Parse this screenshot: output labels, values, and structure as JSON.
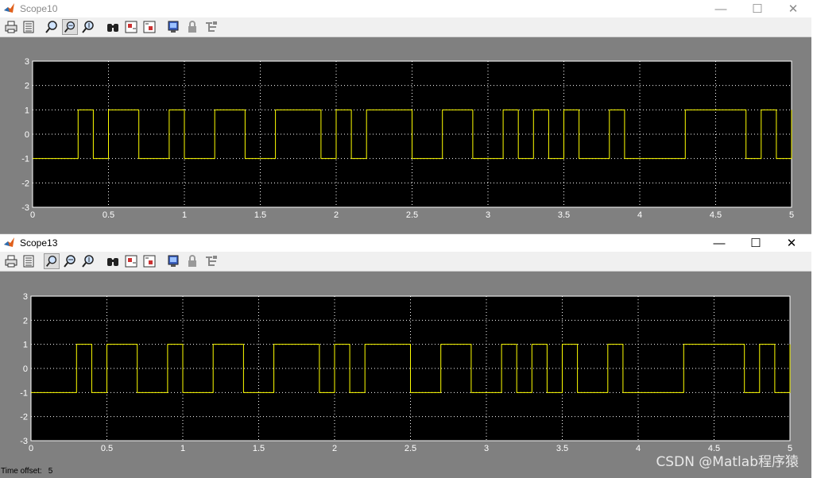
{
  "windows": [
    {
      "title": "Scope10",
      "toolbar_icons": [
        "print-icon",
        "parameters-icon",
        "zoom-icon",
        "zoom-x-icon",
        "zoom-y-icon",
        "autoscale-icon",
        "save-axes-icon",
        "restore-axes-icon",
        "floating-scope-icon",
        "lock-icon",
        "signal-selector-icon"
      ],
      "pressed_tool": "zoom-x-icon"
    },
    {
      "title": "Scope13",
      "toolbar_icons": [
        "print-icon",
        "parameters-icon",
        "zoom-icon",
        "zoom-x-icon",
        "zoom-y-icon",
        "autoscale-icon",
        "save-axes-icon",
        "restore-axes-icon",
        "floating-scope-icon",
        "lock-icon",
        "signal-selector-icon"
      ],
      "pressed_tool": "zoom-icon"
    }
  ],
  "window_controls": {
    "minimize": "—",
    "maximize": "☐",
    "close": "✕"
  },
  "colors": {
    "plot_bg": "#000000",
    "trace": "#ffff00",
    "frame_bg": "#808080",
    "grid": "#ffffff",
    "axis_text": "#ffffff"
  },
  "chart_data": [
    {
      "type": "line",
      "title": "",
      "xlabel": "",
      "ylabel": "",
      "xlim": [
        0,
        5
      ],
      "ylim": [
        -3,
        3
      ],
      "xticks": [
        "0",
        "0.5",
        "1",
        "1.5",
        "2",
        "2.5",
        "3",
        "3.5",
        "4",
        "4.5",
        "5"
      ],
      "yticks": [
        "3",
        "2",
        "1",
        "0",
        "-1",
        "-2",
        "-3"
      ],
      "grid": true,
      "step": true,
      "x": [
        0,
        0.3,
        0.4,
        0.5,
        0.7,
        0.9,
        1.0,
        1.2,
        1.4,
        1.6,
        1.9,
        2.0,
        2.1,
        2.2,
        2.5,
        2.7,
        2.9,
        3.1,
        3.2,
        3.3,
        3.4,
        3.5,
        3.6,
        3.8,
        3.9,
        4.3,
        4.7,
        4.8,
        4.9,
        5.0
      ],
      "y": [
        -1,
        1,
        -1,
        1,
        -1,
        1,
        -1,
        1,
        -1,
        1,
        -1,
        1,
        -1,
        1,
        -1,
        1,
        -1,
        1,
        -1,
        1,
        -1,
        1,
        -1,
        1,
        -1,
        1,
        -1,
        1,
        -1,
        1
      ]
    },
    {
      "type": "line",
      "title": "",
      "xlabel": "",
      "ylabel": "",
      "xlim": [
        0,
        5
      ],
      "ylim": [
        -3,
        3
      ],
      "xticks": [
        "0",
        "0.5",
        "1",
        "1.5",
        "2",
        "2.5",
        "3",
        "3.5",
        "4",
        "4.5",
        "5"
      ],
      "yticks": [
        "3",
        "2",
        "1",
        "0",
        "-1",
        "-2",
        "-3"
      ],
      "grid": true,
      "step": true,
      "x": [
        0,
        0.3,
        0.4,
        0.5,
        0.7,
        0.9,
        1.0,
        1.2,
        1.4,
        1.6,
        1.9,
        2.0,
        2.1,
        2.2,
        2.5,
        2.7,
        2.9,
        3.1,
        3.2,
        3.3,
        3.4,
        3.5,
        3.6,
        3.8,
        3.9,
        4.3,
        4.7,
        4.8,
        4.9,
        5.0
      ],
      "y": [
        -1,
        1,
        -1,
        1,
        -1,
        1,
        -1,
        1,
        -1,
        1,
        -1,
        1,
        -1,
        1,
        -1,
        1,
        -1,
        1,
        -1,
        1,
        -1,
        1,
        -1,
        1,
        -1,
        1,
        -1,
        1,
        -1,
        1
      ]
    }
  ],
  "time_offset_label": "Time offset:",
  "time_offset_value": "5",
  "watermark": "CSDN @Matlab程序猿"
}
